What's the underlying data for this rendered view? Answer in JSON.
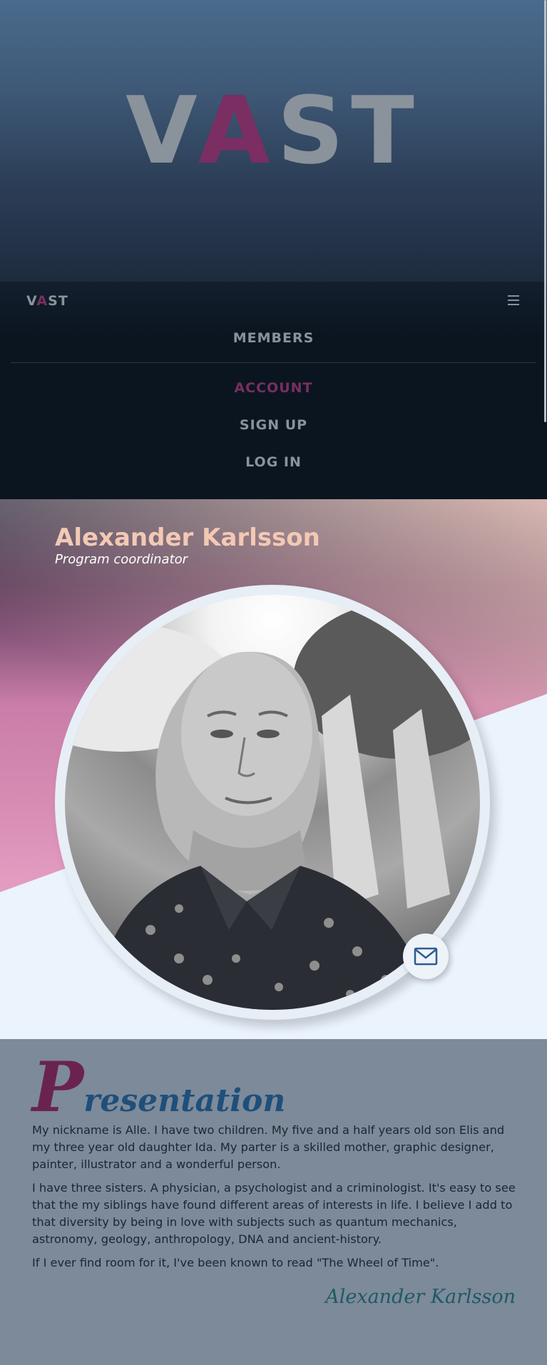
{
  "brand": {
    "prefix": "V",
    "accent": "A",
    "suffix": "ST",
    "accent_color": "#7a2e62"
  },
  "nav": {
    "menu_icon": "hamburger-icon",
    "items": [
      {
        "label": "MEMBERS",
        "active": false
      },
      {
        "label": "ACCOUNT",
        "active": true
      },
      {
        "label": "SIGN UP",
        "active": false
      },
      {
        "label": "LOG IN",
        "active": false
      }
    ]
  },
  "profile": {
    "name": "Alexander Karlsson",
    "role": "Program coordinator",
    "mail_icon": "envelope-icon",
    "name_color": "#f3c9b4"
  },
  "presentation": {
    "title_initial": "P",
    "title_rest": "resentation",
    "paragraphs": [
      "My nickname is Alle. I have two children. My five and a half years old son Elis and my three year old daughter Ida. My parter is a skilled mother, graphic designer, painter, illustrator and a wonderful person.",
      "I have three sisters. A physician, a psychologist and a criminologist. It's easy to see that the my siblings have found different areas of interests in life. I believe I add to that diversity by being in love with subjects such as quantum mechanics, astronomy, geology, anthropology, DNA and ancient-history.",
      "If I ever find room for it, I've been known to read \"The Wheel of Time\"."
    ],
    "signature": "Alexander Karlsson"
  }
}
